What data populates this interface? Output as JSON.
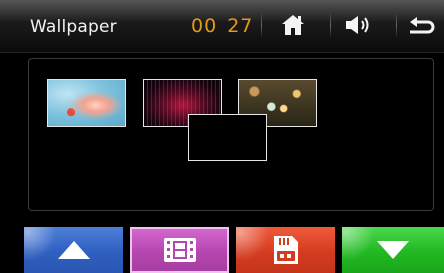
{
  "header": {
    "title": "Wallpaper",
    "clock": {
      "hours": "00",
      "minutes": "27"
    },
    "icons": [
      "home-icon",
      "volume-icon",
      "back-icon"
    ]
  },
  "gallery": {
    "thumbnails": [
      {
        "name": "wallpaper-thumbnail-1",
        "selected": false
      },
      {
        "name": "wallpaper-thumbnail-2",
        "selected": false
      },
      {
        "name": "wallpaper-thumbnail-3",
        "selected": false
      },
      {
        "name": "wallpaper-thumbnail-4",
        "selected": true
      }
    ]
  },
  "bottom_bar": {
    "buttons": [
      {
        "name": "scroll-up-button",
        "icon": "arrow-up-icon",
        "color": "#2f5fc0"
      },
      {
        "name": "video-button",
        "icon": "film-icon",
        "color": "#b546b0"
      },
      {
        "name": "sd-card-button",
        "icon": "sd-card-icon",
        "color": "#d43c20"
      },
      {
        "name": "scroll-down-button",
        "icon": "arrow-down-icon",
        "color": "#22b822"
      }
    ]
  },
  "colors": {
    "clock": "#e49a17",
    "background": "#000000"
  }
}
